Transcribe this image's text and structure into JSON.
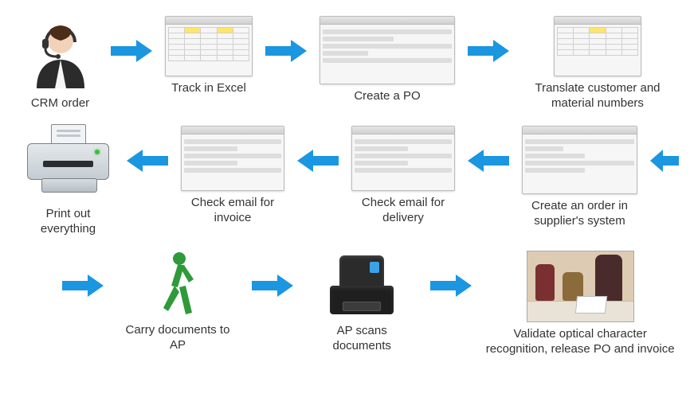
{
  "steps": {
    "crm_order": "CRM order",
    "track_excel": "Track in Excel",
    "create_po": "Create a PO",
    "translate": "Translate customer and material numbers",
    "print": "Print out everything",
    "check_invoice": "Check email for invoice",
    "check_delivery": "Check email for delivery",
    "create_order_supplier": "Create an order in supplier's system",
    "carry_ap": "Carry documents to AP",
    "ap_scan": "AP scans documents",
    "validate": "Validate optical character recognition, release PO and invoice"
  },
  "arrow_color": "#1b96e0",
  "flow_sequence": [
    "crm_order",
    "track_excel",
    "create_po",
    "translate",
    "create_order_supplier",
    "check_delivery",
    "check_invoice",
    "print",
    "carry_ap",
    "ap_scan",
    "validate"
  ]
}
